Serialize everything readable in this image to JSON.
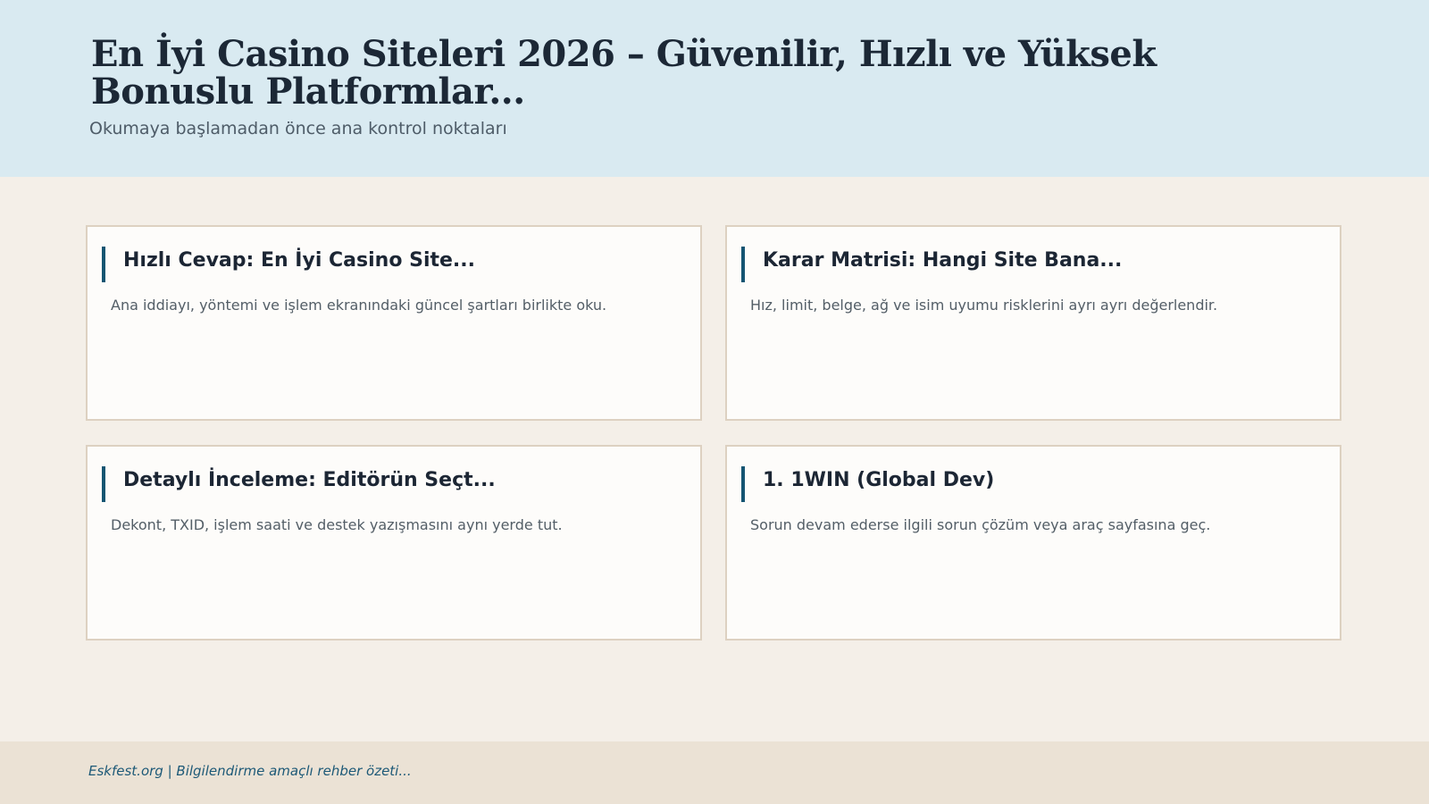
{
  "header": {
    "title": "En İyi Casino Siteleri 2026 – Güvenilir, Hızlı ve Yüksek Bonuslu Platformlar...",
    "subtitle": "Okumaya başlamadan önce ana kontrol noktaları"
  },
  "cards": [
    {
      "title": "Hızlı Cevap: En İyi Casino Site...",
      "description": "Ana iddiayı, yöntemi ve işlem ekranındaki güncel şartları birlikte oku."
    },
    {
      "title": "Karar Matrisi: Hangi Site Bana...",
      "description": "Hız, limit, belge, ağ ve isim uyumu risklerini ayrı ayrı değerlendir."
    },
    {
      "title": "Detaylı İnceleme: Editörün Seçt...",
      "description": "Dekont, TXID, işlem saati ve destek yazışmasını aynı yerde tut."
    },
    {
      "title": "1. 1WIN (Global Dev)",
      "description": "Sorun devam ederse ilgili sorun çözüm veya araç sayfasına geç."
    }
  ],
  "footer": {
    "text": "Eskfest.org | Bilgilendirme amaçlı rehber özeti..."
  },
  "colors": {
    "header_bg": "#d9eaf1",
    "page_bg": "#f4efe8",
    "card_bg": "#fdfcfa",
    "card_border": "#ddd1c1",
    "accent": "#155572",
    "footer_bg": "#ebe2d5",
    "footer_text": "#1d5977"
  }
}
